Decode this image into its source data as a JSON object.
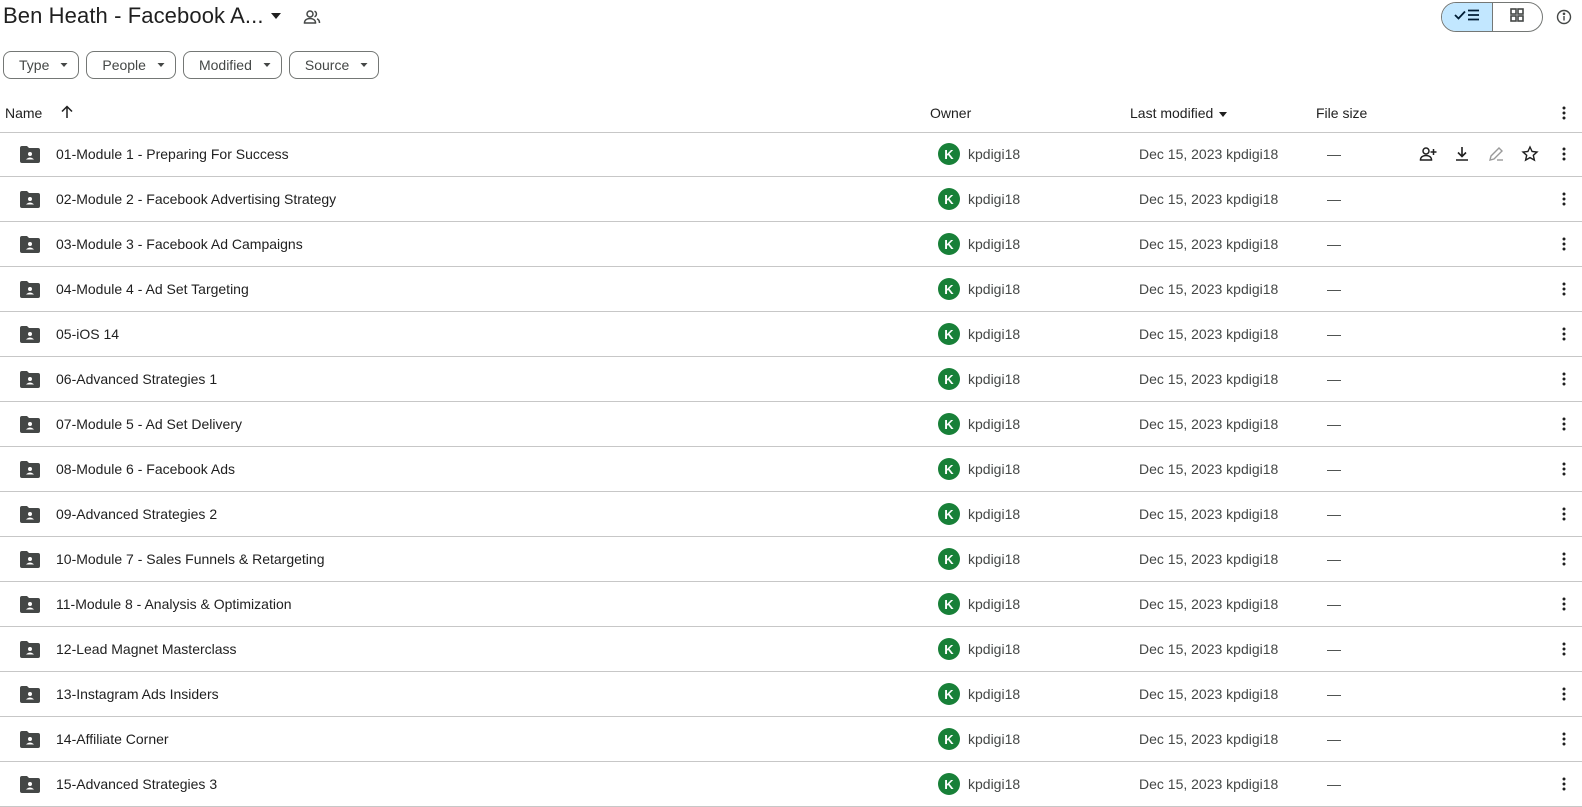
{
  "header": {
    "title": "Ben Heath - Facebook A...",
    "title_caret_icon": "caret-down-icon",
    "shared_icon": "people-icon",
    "view_toggle": {
      "list_icon": "check-list-icon",
      "grid_icon": "grid-icon",
      "active": "list"
    },
    "info_icon": "info-icon"
  },
  "filters": [
    {
      "label": "Type"
    },
    {
      "label": "People"
    },
    {
      "label": "Modified"
    },
    {
      "label": "Source"
    }
  ],
  "columns": {
    "name": "Name",
    "owner": "Owner",
    "last_modified": "Last modified",
    "file_size": "File size"
  },
  "row_actions": [
    "add-person-icon",
    "download-icon",
    "rename-icon",
    "star-icon"
  ],
  "rows": [
    {
      "name": "01-Module 1 - Preparing For Success",
      "owner_initial": "K",
      "owner": "kpdigi18",
      "modified": "Dec 15, 2023 kpdigi18",
      "size": "—"
    },
    {
      "name": "02-Module 2 - Facebook Advertising Strategy",
      "owner_initial": "K",
      "owner": "kpdigi18",
      "modified": "Dec 15, 2023 kpdigi18",
      "size": "—"
    },
    {
      "name": "03-Module 3 - Facebook Ad Campaigns",
      "owner_initial": "K",
      "owner": "kpdigi18",
      "modified": "Dec 15, 2023 kpdigi18",
      "size": "—"
    },
    {
      "name": "04-Module 4 - Ad Set Targeting",
      "owner_initial": "K",
      "owner": "kpdigi18",
      "modified": "Dec 15, 2023 kpdigi18",
      "size": "—"
    },
    {
      "name": "05-iOS 14",
      "owner_initial": "K",
      "owner": "kpdigi18",
      "modified": "Dec 15, 2023 kpdigi18",
      "size": "—"
    },
    {
      "name": "06-Advanced Strategies 1",
      "owner_initial": "K",
      "owner": "kpdigi18",
      "modified": "Dec 15, 2023 kpdigi18",
      "size": "—"
    },
    {
      "name": "07-Module 5 - Ad Set Delivery",
      "owner_initial": "K",
      "owner": "kpdigi18",
      "modified": "Dec 15, 2023 kpdigi18",
      "size": "—"
    },
    {
      "name": "08-Module 6 - Facebook Ads",
      "owner_initial": "K",
      "owner": "kpdigi18",
      "modified": "Dec 15, 2023 kpdigi18",
      "size": "—"
    },
    {
      "name": "09-Advanced Strategies 2",
      "owner_initial": "K",
      "owner": "kpdigi18",
      "modified": "Dec 15, 2023 kpdigi18",
      "size": "—"
    },
    {
      "name": "10-Module 7 - Sales Funnels & Retargeting",
      "owner_initial": "K",
      "owner": "kpdigi18",
      "modified": "Dec 15, 2023 kpdigi18",
      "size": "—"
    },
    {
      "name": "11-Module 8 - Analysis & Optimization",
      "owner_initial": "K",
      "owner": "kpdigi18",
      "modified": "Dec 15, 2023 kpdigi18",
      "size": "—"
    },
    {
      "name": "12-Lead Magnet Masterclass",
      "owner_initial": "K",
      "owner": "kpdigi18",
      "modified": "Dec 15, 2023 kpdigi18",
      "size": "—"
    },
    {
      "name": "13-Instagram Ads Insiders",
      "owner_initial": "K",
      "owner": "kpdigi18",
      "modified": "Dec 15, 2023 kpdigi18",
      "size": "—"
    },
    {
      "name": "14-Affiliate Corner",
      "owner_initial": "K",
      "owner": "kpdigi18",
      "modified": "Dec 15, 2023 kpdigi18",
      "size": "—"
    },
    {
      "name": "15-Advanced Strategies 3",
      "owner_initial": "K",
      "owner": "kpdigi18",
      "modified": "Dec 15, 2023 kpdigi18",
      "size": "—"
    }
  ],
  "colors": {
    "avatar": "#188038",
    "toggle_active": "#c2e7ff",
    "divider": "#c7c7c7"
  }
}
